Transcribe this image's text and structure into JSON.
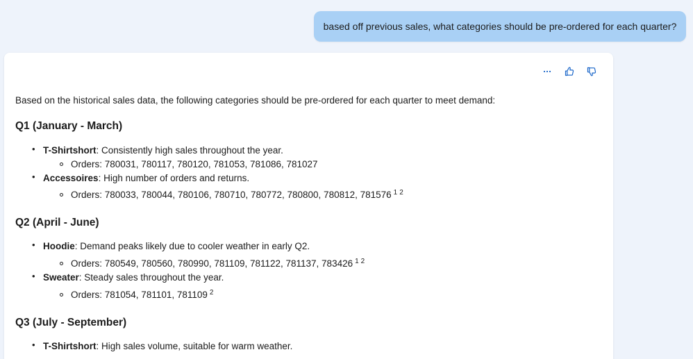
{
  "user_message": {
    "text": "based off previous sales, what categories should be pre-ordered for each quarter?"
  },
  "actions": {
    "more_icon": "more-icon",
    "like_icon": "thumbs-up-icon",
    "dislike_icon": "thumbs-down-icon"
  },
  "response": {
    "intro": "Based on the historical sales data, the following categories should be pre-ordered for each quarter to meet demand:",
    "sections": [
      {
        "heading": "Q1 (January - March)",
        "items": [
          {
            "name": "T-Shirtshort",
            "desc": ": Consistently high sales throughout the year.",
            "orders": "Orders: 780031, 780117, 780120, 781053, 781086, 781027",
            "cites": []
          },
          {
            "name": "Accessoires",
            "desc": ": High number of orders and returns.",
            "orders": "Orders: 780033, 780044, 780106, 780710, 780772, 780800, 780812, 781576",
            "cites": [
              "1",
              "2"
            ]
          }
        ]
      },
      {
        "heading": "Q2 (April - June)",
        "items": [
          {
            "name": "Hoodie",
            "desc": ": Demand peaks likely due to cooler weather in early Q2.",
            "orders": "Orders: 780549, 780560, 780990, 781109, 781122, 781137, 783426",
            "cites": [
              "1",
              "2"
            ]
          },
          {
            "name": "Sweater",
            "desc": ": Steady sales throughout the year.",
            "orders": "Orders: 781054, 781101, 781109",
            "cites": [
              "2"
            ]
          }
        ]
      },
      {
        "heading": "Q3 (July - September)",
        "items": [
          {
            "name": "T-Shirtshort",
            "desc": ": High sales volume, suitable for warm weather."
          }
        ]
      }
    ]
  },
  "colors": {
    "page_background": "#eef3fb",
    "user_bubble": "#a9d0f5",
    "card_background": "#ffffff",
    "accent": "#1a66c9"
  }
}
